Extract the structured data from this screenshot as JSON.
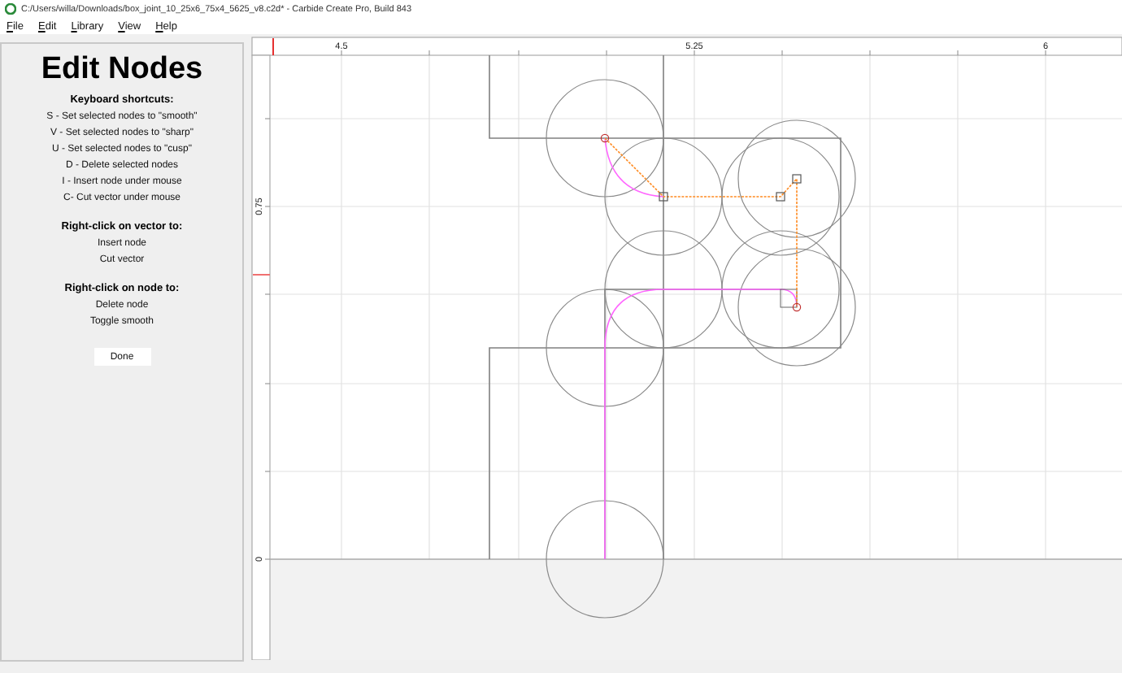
{
  "window": {
    "title": "C:/Users/willa/Downloads/box_joint_10_25x6_75x4_5625_v8.c2d* - Carbide Create Pro, Build 843"
  },
  "menu": [
    "File",
    "Edit",
    "Library",
    "View",
    "Help"
  ],
  "panel": {
    "title": "Edit Nodes",
    "sections": [
      {
        "heading": "Keyboard shortcuts:",
        "lines": [
          "S - Set selected nodes to \"smooth\"",
          "V - Set selected nodes to \"sharp\"",
          "U - Set selected nodes to \"cusp\"",
          "D - Delete selected nodes",
          "I - Insert node under mouse",
          "C- Cut vector under mouse"
        ]
      },
      {
        "heading": "Right-click on vector to:",
        "lines": [
          "Insert node",
          "Cut vector"
        ]
      },
      {
        "heading": "Right-click on node to:",
        "lines": [
          "Delete node",
          "Toggle smooth"
        ]
      }
    ],
    "done_button": "Done"
  },
  "rulers": {
    "x_labels": [
      "4.5",
      "5.25",
      "6"
    ],
    "y_labels": [
      "0.75",
      "0"
    ]
  }
}
